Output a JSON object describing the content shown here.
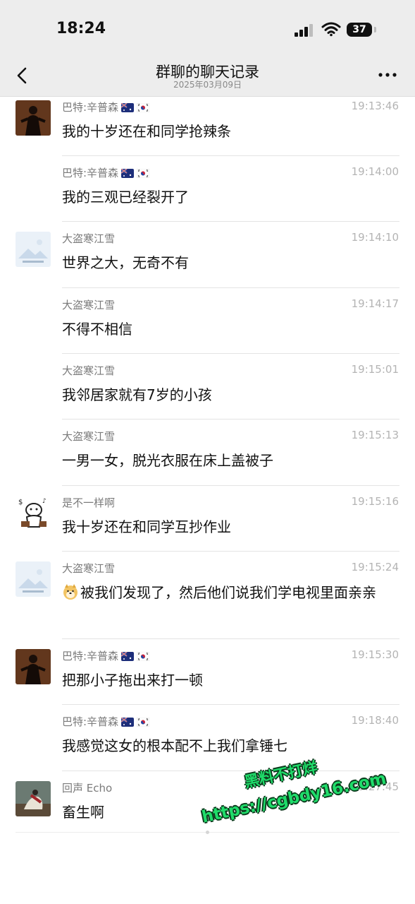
{
  "status": {
    "time": "18:24",
    "battery": "37"
  },
  "header": {
    "title": "群聊的聊天记录",
    "date": "2025年03月09日"
  },
  "messages": [
    {
      "sender": "巴特:辛普森",
      "time": "19:13:46",
      "text": "我的十岁还在和同学抢辣条",
      "avatar": "movie-avatar",
      "flags": true
    },
    {
      "sender": "巴特:辛普森",
      "time": "19:14:00",
      "text": "我的三观已经裂开了",
      "avatar": "",
      "flags": true
    },
    {
      "sender": "大盗寒江雪",
      "time": "19:14:10",
      "text": "世界之大，无奇不有",
      "avatar": "placeholder-avatar",
      "flags": false
    },
    {
      "sender": "大盗寒江雪",
      "time": "19:14:17",
      "text": "不得不相信",
      "avatar": "",
      "flags": false
    },
    {
      "sender": "大盗寒江雪",
      "time": "19:15:01",
      "text": "我邻居家就有7岁的小孩",
      "avatar": "",
      "flags": false
    },
    {
      "sender": "大盗寒江雪",
      "time": "19:15:13",
      "text": "一男一女，脱光衣服在床上盖被子",
      "avatar": "",
      "flags": false
    },
    {
      "sender": "是不一样啊",
      "time": "19:15:16",
      "text": "我十岁还在和同学互抄作业",
      "avatar": "cartoon-avatar",
      "flags": false
    },
    {
      "sender": "大盗寒江雪",
      "time": "19:15:24",
      "text": "被我们发现了，然后他们说我们学电视里面亲亲",
      "avatar": "placeholder-avatar",
      "flags": false,
      "emoji": "doge-emoji"
    },
    {
      "sender": "巴特:辛普森",
      "time": "19:15:30",
      "text": "把那小子拖出来打一顿",
      "avatar": "movie-avatar",
      "flags": true
    },
    {
      "sender": "巴特:辛普森",
      "time": "19:18:40",
      "text": "我感觉这女的根本配不上我们拿锤七",
      "avatar": "",
      "flags": true
    },
    {
      "sender": "回声 Echo",
      "time": "19:27:45",
      "text": "畜生啊",
      "avatar": "painting-avatar",
      "flags": false
    }
  ],
  "watermark": {
    "line1": "黑料不打烊",
    "line2": "https://cgbdy16.com"
  },
  "colors": {
    "nav_bg": "#ededed",
    "watermark": "#1fdc6a"
  }
}
